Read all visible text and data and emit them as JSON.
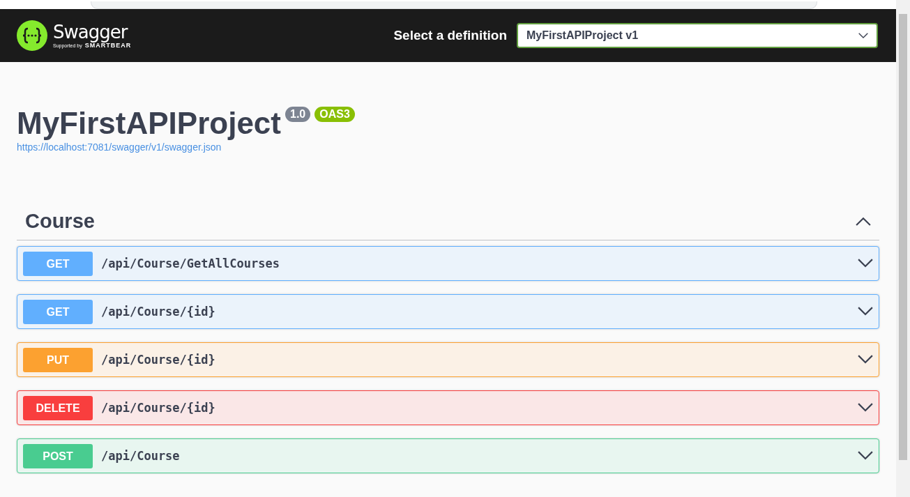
{
  "topbar": {
    "logo_name": "Swagger",
    "logo_tagline": "Supported by",
    "logo_brand": "SMARTBEAR",
    "definition_label": "Select a definition",
    "definition_value": "MyFirstAPIProject v1"
  },
  "info": {
    "title": "MyFirstAPIProject",
    "version": "1.0",
    "spec": "OAS3",
    "url": "https://localhost:7081/swagger/v1/swagger.json"
  },
  "section": {
    "name": "Course",
    "expanded": true,
    "operations": [
      {
        "method": "GET",
        "path": "/api/Course/GetAllCourses",
        "expanded": false
      },
      {
        "method": "GET",
        "path": "/api/Course/{id}",
        "expanded": false
      },
      {
        "method": "PUT",
        "path": "/api/Course/{id}",
        "expanded": false
      },
      {
        "method": "DELETE",
        "path": "/api/Course/{id}",
        "expanded": false
      },
      {
        "method": "POST",
        "path": "/api/Course",
        "expanded": false
      }
    ]
  }
}
